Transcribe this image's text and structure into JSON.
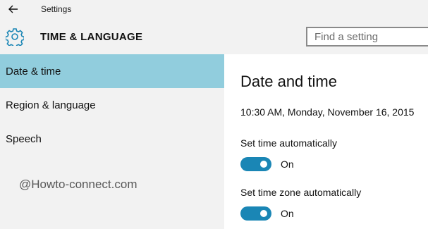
{
  "titlebar": {
    "app_title": "Settings",
    "back_icon": "arrow-left-icon"
  },
  "header": {
    "section_icon": "gear-icon",
    "section_title": "TIME & LANGUAGE",
    "search_placeholder": "Find a setting",
    "search_value": ""
  },
  "sidebar": {
    "items": [
      {
        "label": "Date & time",
        "selected": true
      },
      {
        "label": "Region & language",
        "selected": false
      },
      {
        "label": "Speech",
        "selected": false
      }
    ],
    "watermark": "@Howto-connect.com"
  },
  "content": {
    "title": "Date and time",
    "current_datetime": "10:30 AM, Monday, November 16, 2015",
    "settings": [
      {
        "label": "Set time automatically",
        "state": "On",
        "enabled": true
      },
      {
        "label": "Set time zone automatically",
        "state": "On",
        "enabled": true
      }
    ]
  },
  "colors": {
    "accent": "#1a86b5",
    "selected_nav": "#91cddd",
    "chrome_bg": "#f2f2f2"
  }
}
